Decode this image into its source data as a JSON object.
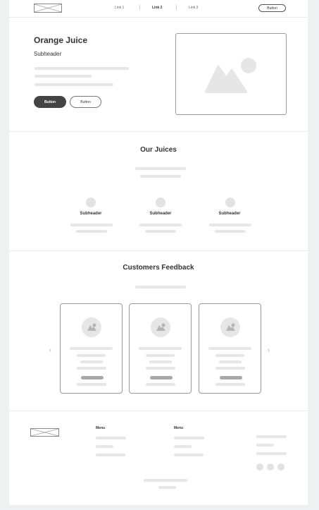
{
  "nav": {
    "links": [
      "Link 1",
      "Link 2",
      "Link 3"
    ],
    "active_link": "Link 2",
    "button_label": "Button"
  },
  "hero": {
    "title": "Orange Juice",
    "subheader": "Subheader",
    "primary_button": "Button",
    "secondary_button": "Button",
    "image_icon": "image-placeholder-icon"
  },
  "juices": {
    "title": "Our Juices",
    "items": [
      {
        "label": "Subheader"
      },
      {
        "label": "Subheader"
      },
      {
        "label": "Subheader"
      }
    ]
  },
  "feedback": {
    "title": "Customers Feedback",
    "prev_arrow": "‹",
    "next_arrow": "›"
  },
  "footer": {
    "menus": [
      "Menu",
      "Menu"
    ]
  },
  "colors": {
    "primary_button_bg": "#444444",
    "page_bg": "#eef0f2",
    "placeholder": "#e6e6e6"
  }
}
